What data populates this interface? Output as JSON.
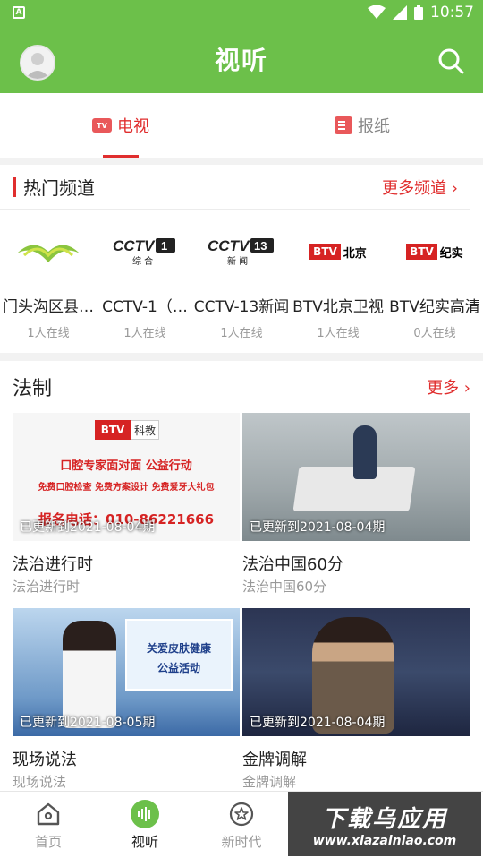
{
  "status_bar": {
    "time": "10:57"
  },
  "app_bar": {
    "title": "视听"
  },
  "tabs": [
    {
      "label": "电视",
      "icon": "tv-icon",
      "active": true
    },
    {
      "label": "报纸",
      "icon": "newspaper-icon",
      "active": false
    }
  ],
  "hot_channels": {
    "title": "热门频道",
    "more_label": "更多频道 ›",
    "items": [
      {
        "name": "门头沟区县…",
        "online": "1人在线",
        "logo": "green-arc-logo"
      },
      {
        "name": "CCTV-1（…",
        "online": "1人在线",
        "logo": "cctv1-logo"
      },
      {
        "name": "CCTV-13新闻",
        "online": "1人在线",
        "logo": "cctv13-logo"
      },
      {
        "name": "BTV北京卫视",
        "online": "1人在线",
        "logo": "btv-beijing-logo"
      },
      {
        "name": "BTV纪实高清",
        "online": "0人在线",
        "logo": "btv-jishi-logo"
      }
    ],
    "logo_text": {
      "cctv1_top": "CCTV",
      "cctv1_num": "1",
      "cctv1_sub": "综 合",
      "cctv13_top": "CCTV",
      "cctv13_num": "13",
      "cctv13_sub": "新 闻",
      "btv": "BTV",
      "beijing": "北京",
      "jishi": "纪实"
    }
  },
  "legal": {
    "title": "法制",
    "more_label": "更多 ›",
    "cards": [
      {
        "updated": "已更新到2021-08-04期",
        "title": "法治进行时",
        "sub": "法治进行时",
        "thumb": {
          "brand": "BTV",
          "brand_sub": "科教",
          "line1": "口腔专家面对面 公益行动",
          "line2": "免费口腔检查 免费方案设计 免费爱牙大礼包",
          "line3": "报名电话：010-86221666"
        }
      },
      {
        "updated": "已更新到2021-08-04期",
        "title": "法治中国60分",
        "sub": "法治中国60分",
        "thumb": {}
      },
      {
        "updated": "已更新到2021-08-05期",
        "title": "现场说法",
        "sub": "现场说法",
        "thumb": {
          "board1": "关爱皮肤健康",
          "board2": "公益活动"
        }
      },
      {
        "updated": "已更新到2021-08-04期",
        "title": "金牌调解",
        "sub": "金牌调解",
        "thumb": {}
      }
    ]
  },
  "bottom_nav": [
    {
      "label": "首页",
      "icon": "home-icon",
      "active": false
    },
    {
      "label": "视听",
      "icon": "audio-wave-icon",
      "active": true
    },
    {
      "label": "新时代",
      "icon": "star-circle-icon",
      "active": false
    }
  ],
  "watermark": {
    "big": "下载乌应用",
    "small": "www.xiazainiao.com"
  },
  "colors": {
    "green": "#6cc04a",
    "red": "#e02e2e"
  }
}
